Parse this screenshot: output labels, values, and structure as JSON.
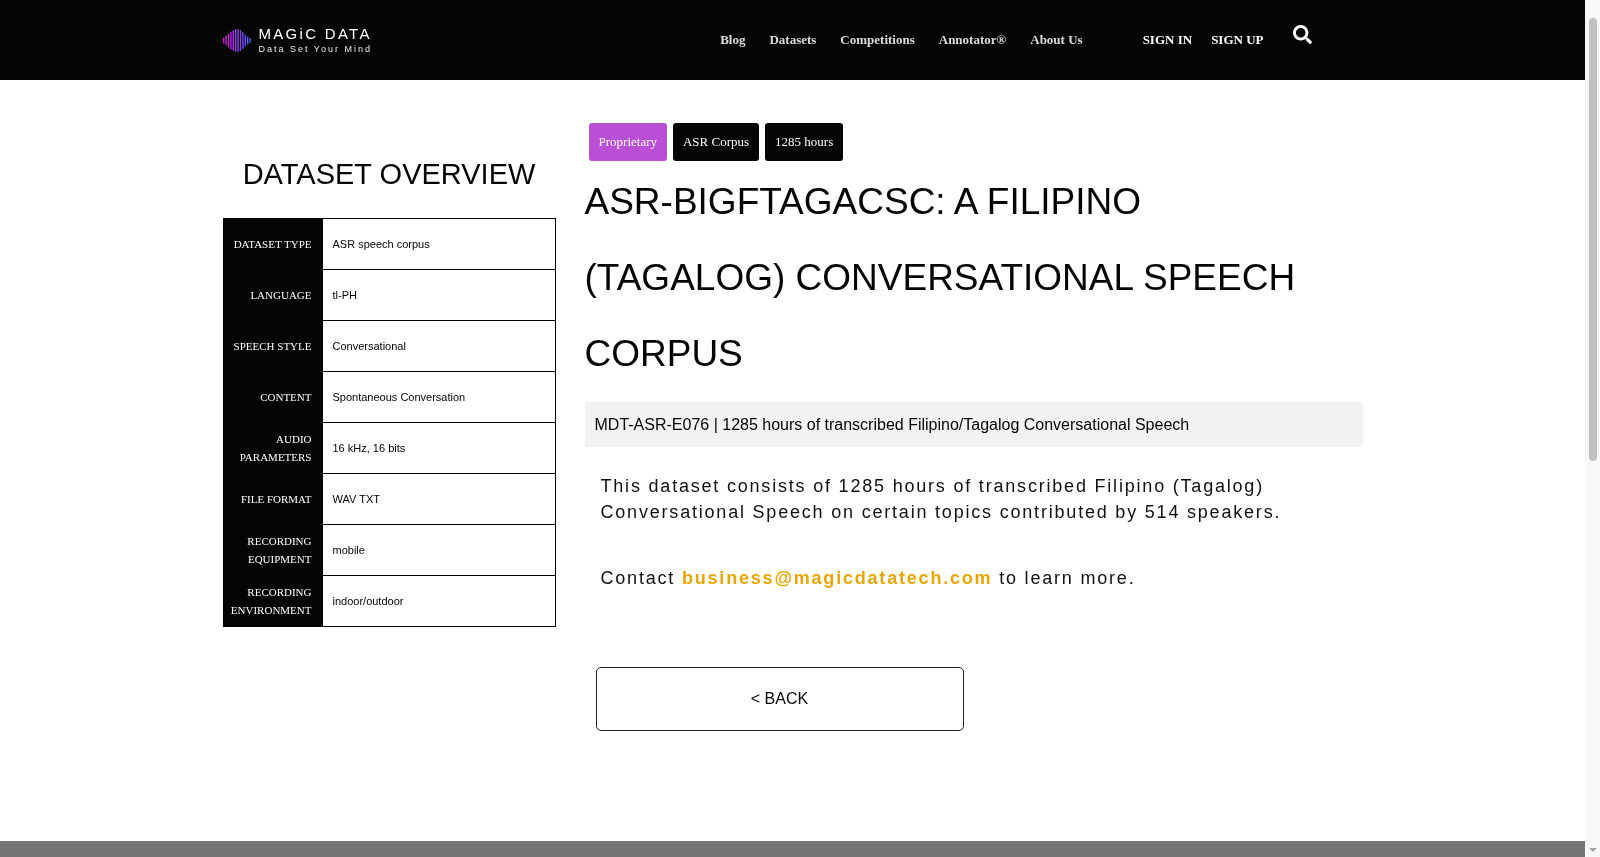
{
  "header": {
    "logo": {
      "name": "MAGiC DATA",
      "tagline": "Data Set Your Mind"
    },
    "nav": [
      "Blog",
      "Datasets",
      "Competitions",
      "Annotator®",
      "About Us"
    ],
    "auth": [
      "SIGN IN",
      "SIGN UP"
    ]
  },
  "overview": {
    "title": "DATASET OVERVIEW",
    "rows": [
      {
        "label": "DATASET TYPE",
        "value": "ASR speech corpus"
      },
      {
        "label": "LANGUAGE",
        "value": "tl-PH"
      },
      {
        "label": "SPEECH STYLE",
        "value": "Conversational"
      },
      {
        "label": "CONTENT",
        "value": "Spontaneous Conversation"
      },
      {
        "label": "AUDIO PARAMETERS",
        "value": "16 kHz, 16 bits"
      },
      {
        "label": "FILE FORMAT",
        "value": "WAV TXT"
      },
      {
        "label": "RECORDING EQUIPMENT",
        "value": "mobile"
      },
      {
        "label": "RECORDING ENVIRONMENT",
        "value": "indoor/outdoor"
      }
    ]
  },
  "tags": [
    {
      "label": "Proprietary",
      "color": "#b94fd4"
    },
    {
      "label": "ASR Corpus",
      "color": "#050505"
    },
    {
      "label": "1285 hours",
      "color": "#050505"
    }
  ],
  "title": "ASR-BIGFTAGACSC: A FILIPINO (TAGALOG) CONVERSATIONAL SPEECH CORPUS",
  "summary": "MDT-ASR-E076 | 1285 hours of transcribed Filipino/Tagalog Conversational Speech",
  "description": "This dataset consists of 1285 hours of transcribed Filipino (Tagalog) Conversational Speech on certain topics contributed by 514 speakers.",
  "contact": {
    "before": "Contact",
    "email": "business@magicdatatech.com",
    "after": "to learn more."
  },
  "back_button": "< BACK"
}
